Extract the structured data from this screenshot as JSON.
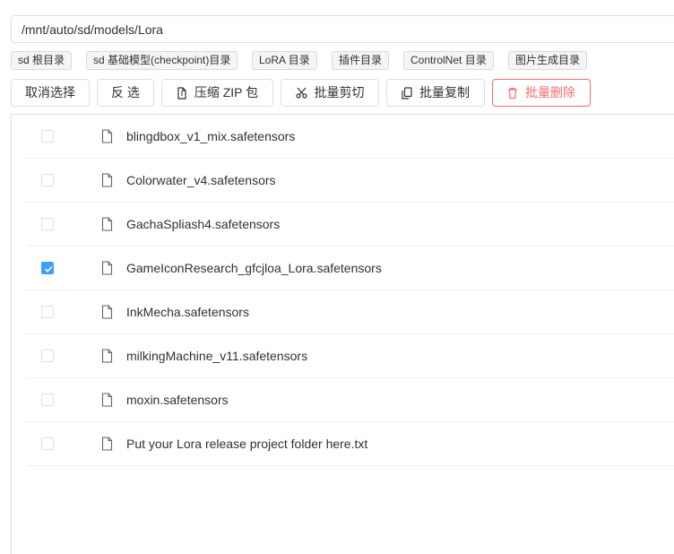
{
  "path": {
    "value": "/mnt/auto/sd/models/Lora"
  },
  "shortcuts": [
    {
      "label": "sd 根目录"
    },
    {
      "label": "sd 基础模型(checkpoint)目录"
    },
    {
      "label": "LoRA 目录"
    },
    {
      "label": "插件目录"
    },
    {
      "label": "ControlNet 目录"
    },
    {
      "label": "图片生成目录"
    }
  ],
  "toolbar": {
    "deselect_label": "取消选择",
    "invert_label": "反 选",
    "zip_label": "压缩 ZIP 包",
    "cut_label": "批量剪切",
    "copy_label": "批量复制",
    "delete_label": "批量删除"
  },
  "files": [
    {
      "name": "blingdbox_v1_mix.safetensors",
      "checked": false,
      "icon": "file-icon"
    },
    {
      "name": "Colorwater_v4.safetensors",
      "checked": false,
      "icon": "file-icon"
    },
    {
      "name": "GachaSpliash4.safetensors",
      "checked": false,
      "icon": "file-icon"
    },
    {
      "name": "GameIconResearch_gfcjloa_Lora.safetensors",
      "checked": true,
      "icon": "file-icon"
    },
    {
      "name": "InkMecha.safetensors",
      "checked": false,
      "icon": "file-icon"
    },
    {
      "name": "milkingMachine_v11.safetensors",
      "checked": false,
      "icon": "file-icon"
    },
    {
      "name": "moxin.safetensors",
      "checked": false,
      "icon": "file-icon"
    },
    {
      "name": "Put your Lora release project folder here.txt",
      "checked": false,
      "icon": "file-icon"
    }
  ],
  "colors": {
    "primary": "#409eff",
    "danger": "#f56c6c",
    "border": "#dcdfe6"
  }
}
